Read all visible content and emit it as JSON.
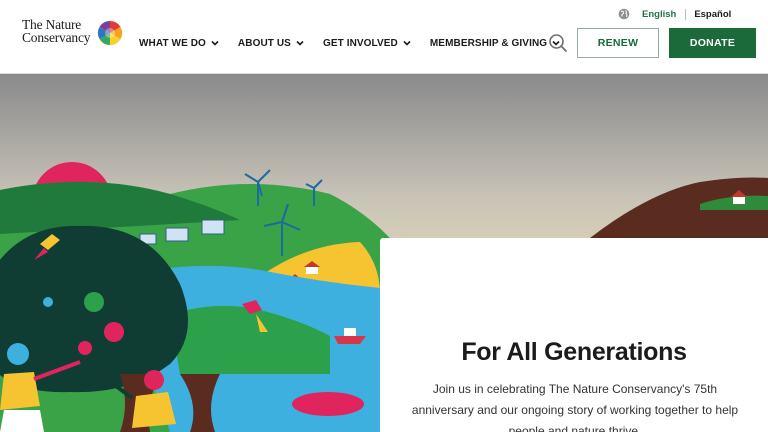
{
  "brand": {
    "logo_line1": "The Nature",
    "logo_line2": "Conservancy"
  },
  "utility": {
    "globe_icon": "globe-icon",
    "lang_english": "English",
    "lang_spanish": "Español"
  },
  "nav": {
    "items": [
      {
        "label": "WHAT WE DO"
      },
      {
        "label": "ABOUT US"
      },
      {
        "label": "GET INVOLVED"
      },
      {
        "label": "MEMBERSHIP & GIVING"
      }
    ]
  },
  "actions": {
    "search_icon": "search-icon",
    "renew_label": "RENEW",
    "donate_label": "DONATE"
  },
  "hero": {
    "title": "For All Generations",
    "body": "Join us in celebrating The Nature Conservancy's 75th anniversary and our ongoing story of working together to help people and nature thrive."
  },
  "colors": {
    "brand_green": "#1b6a39",
    "link_green": "#217346",
    "text_dark": "#1b1b1b"
  }
}
